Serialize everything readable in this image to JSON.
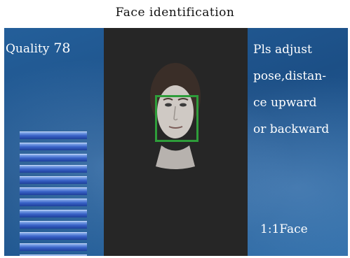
{
  "title": "Face identification",
  "quality": {
    "label": "Quality",
    "value": "78"
  },
  "quality_meter": {
    "segments_filled": 12
  },
  "instructions": {
    "lines": [
      "Pls adjust",
      "pose,distan-",
      "ce upward",
      "or backward"
    ]
  },
  "mode_label": "1:1Face",
  "colors": {
    "screen_blue": "#1f5a93",
    "camera_bg": "#262626",
    "face_box": "#2e9d3a",
    "meter_bar": "#3a63c8"
  }
}
